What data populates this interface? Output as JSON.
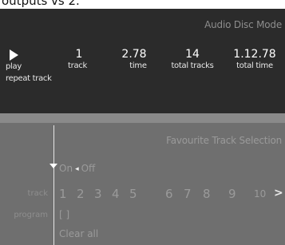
{
  "caption": "outputs vs 2.",
  "mode_title": "Audio Disc Mode",
  "player": {
    "play_label": "play",
    "repeat_label": "repeat track",
    "stats": [
      {
        "value": "1",
        "label": "track"
      },
      {
        "value": "2.78",
        "label": "time"
      },
      {
        "value": "14",
        "label": "total tracks"
      },
      {
        "value": "1.12.78",
        "label": "total time"
      }
    ]
  },
  "favourites": {
    "title": "Favourite Track Selection",
    "on_label": "On",
    "off_label": "Off",
    "selector_glyph": "◂",
    "track_row_label": "track",
    "program_row_label": "program",
    "tracks": [
      "1",
      "2",
      "3",
      "4",
      "5",
      "6",
      "7",
      "8",
      "9",
      "10"
    ],
    "next_glyph": ">",
    "program_value": "[ ]",
    "clear_all_label": "Clear all"
  },
  "colors": {
    "top_panel": "#2b2b2b",
    "bottom_panel": "#6f6f6f",
    "band": "#8a8a8a",
    "text_active": "#ffffff",
    "text_dim": "#9a9a9a"
  }
}
